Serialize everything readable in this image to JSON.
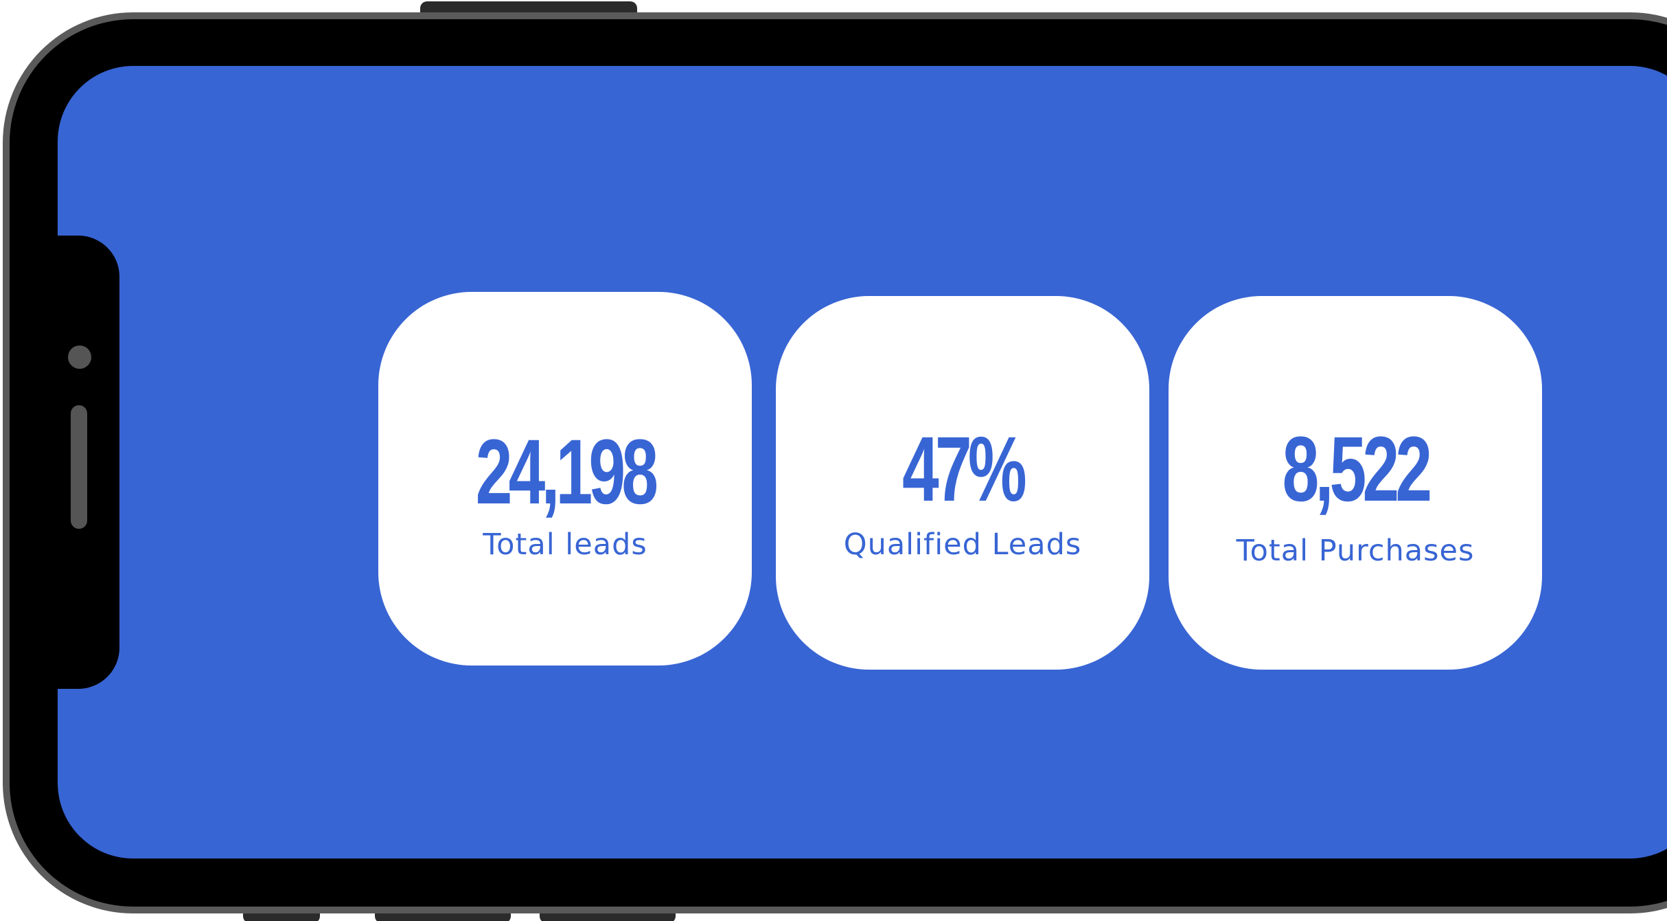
{
  "colors": {
    "screen_background": "#3865d4",
    "card_background": "#ffffff",
    "accent_text": "#3865d4",
    "phone_bezel": "#000000",
    "phone_frame": "#5a5a5a"
  },
  "stats": [
    {
      "value": "24,198",
      "label": "Total leads"
    },
    {
      "value": "47%",
      "label": "Qualified Leads"
    },
    {
      "value": "8,522",
      "label": "Total Purchases"
    }
  ]
}
